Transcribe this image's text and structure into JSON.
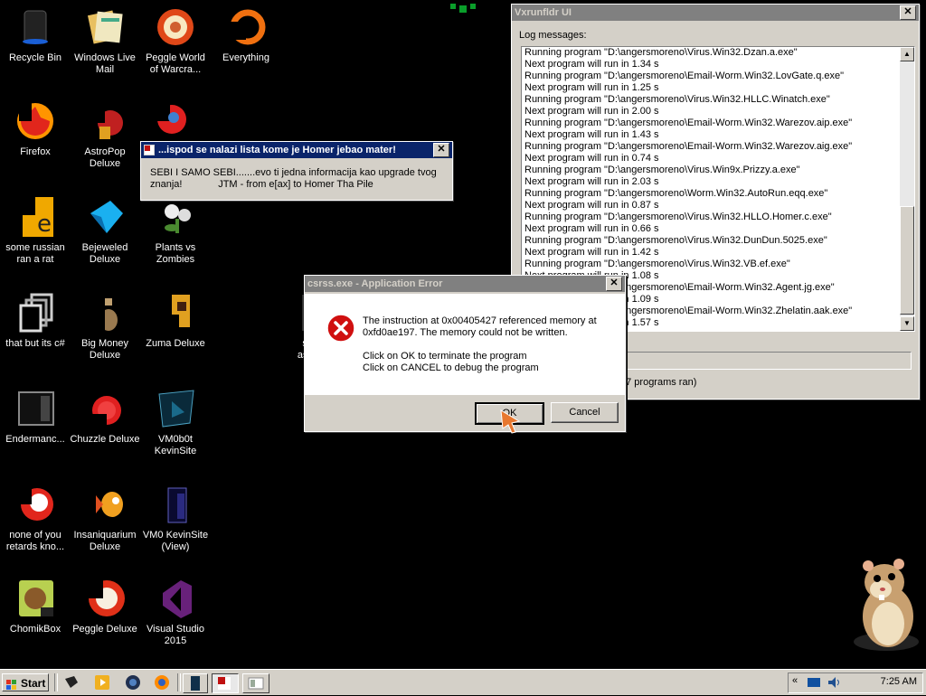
{
  "desktop": {
    "icons": [
      {
        "label": "Recycle Bin"
      },
      {
        "label": "Windows Live Mail"
      },
      {
        "label": "Peggle World of Warcra..."
      },
      {
        "label": "Everything"
      },
      {
        "label": "Firefox"
      },
      {
        "label": "AstroPop Deluxe"
      },
      {
        "label": "some russian ran a rat"
      },
      {
        "label": "Bejeweled Deluxe"
      },
      {
        "label": "Plants vs Zombies"
      },
      {
        "label": "that but its c#"
      },
      {
        "label": "Big Money Deluxe"
      },
      {
        "label": "Zuma Deluxe"
      },
      {
        "label": "Endermanc..."
      },
      {
        "label": "Chuzzle Deluxe"
      },
      {
        "label": "VM0b0t KevinSite"
      },
      {
        "label": "none of you retards kno..."
      },
      {
        "label": "Insaniquarium Deluxe"
      },
      {
        "label": "VM0 KevinSite (View)"
      },
      {
        "label": "ChomikBox"
      },
      {
        "label": "Peggle Deluxe"
      },
      {
        "label": "Visual Studio 2015"
      },
      {
        "label": "sh ask"
      }
    ]
  },
  "homer_msg": {
    "title": "...ispod se nalazi lista kome je Homer jebao mater!",
    "line1": "SEBI I SAMO SEBI.......evo ti jedna informacija kao upgrade tvog",
    "line2": "znanja!             JTM - from e[ax] to Homer Tha Pile",
    "close": "✕"
  },
  "vxrun": {
    "title": "Vxrunfldr UI",
    "log_label": "Log messages:",
    "lines": [
      "Running program \"D:\\angersmoreno\\Virus.Win32.Dzan.a.exe\"",
      "Next program will run in 1.34 s",
      "Running program \"D:\\angersmoreno\\Email-Worm.Win32.LovGate.q.exe\"",
      "Next program will run in 1.25 s",
      "Running program \"D:\\angersmoreno\\Virus.Win32.HLLC.Winatch.exe\"",
      "Next program will run in 2.00 s",
      "Running program \"D:\\angersmoreno\\Email-Worm.Win32.Warezov.aip.exe\"",
      "Next program will run in 1.43 s",
      "Running program \"D:\\angersmoreno\\Email-Worm.Win32.Warezov.aig.exe\"",
      "Next program will run in 0.74 s",
      "Running program \"D:\\angersmoreno\\Virus.Win9x.Prizzy.a.exe\"",
      "Next program will run in 2.03 s",
      "Running program \"D:\\angersmoreno\\Worm.Win32.AutoRun.eqq.exe\"",
      "Next program will run in 0.87 s",
      "Running program \"D:\\angersmoreno\\Virus.Win32.HLLO.Homer.c.exe\"",
      "Next program will run in 0.66 s",
      "Running program \"D:\\angersmoreno\\Virus.Win32.DunDun.5025.exe\"",
      "Next program will run in 1.42 s",
      "Running program \"D:\\angersmoreno\\Virus.Win32.VB.ef.exe\"",
      "Next program will run in 1.08 s",
      "Running program \"D:\\angersmoreno\\Email-Worm.Win32.Agent.jg.exe\"",
      "Next program will run in 1.09 s",
      "Running program \"D:\\angersmoreno\\Email-Worm.Win32.Zhelatin.aak.exe\"",
      "Next program will run in 1.57 s"
    ],
    "status": "27 programs ran)",
    "close": "✕"
  },
  "error_dialog": {
    "title": "csrss.exe - Application Error",
    "msg1": "The instruction at 0x00405427 referenced memory at",
    "msg2": "0xfd0ae197. The memory could not be written.",
    "msg3": "Click on OK to terminate the program",
    "msg4": "Click on CANCEL to debug the program",
    "ok": "OK",
    "cancel": "Cancel",
    "close": "✕",
    "icon_glyph": "✕"
  },
  "taskbar": {
    "start": "Start",
    "clock": "7:25 AM"
  }
}
